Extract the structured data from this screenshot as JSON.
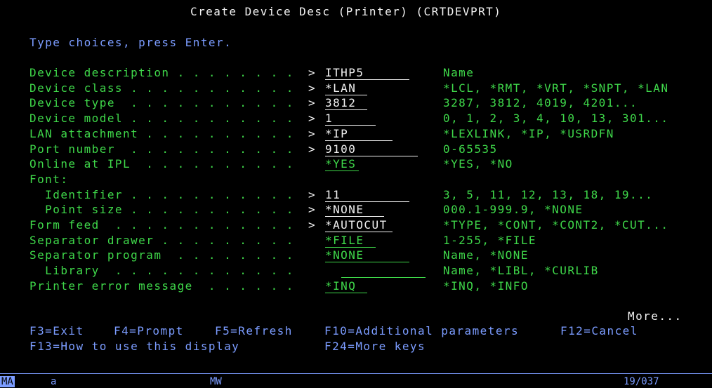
{
  "header": {
    "title": "Create Device Desc (Printer) (CRTDEVPRT)"
  },
  "instructions": "Type choices, press Enter.",
  "parameters": [
    {
      "key": "device_description",
      "prompt": "Device description . . . . . . . .",
      "prompt_marker": ">",
      "value": "ITHP5",
      "choices": "Name"
    },
    {
      "key": "device_class",
      "prompt": "Device class . . . . . . . . . . .",
      "prompt_marker": ">",
      "value": "*LAN",
      "choices": "*LCL, *RMT, *VRT, *SNPT, *LAN"
    },
    {
      "key": "device_type",
      "prompt": "Device type  . . . . . . . . . . .",
      "prompt_marker": ">",
      "value": "3812",
      "choices": "3287, 3812, 4019, 4201..."
    },
    {
      "key": "device_model",
      "prompt": "Device model . . . . . . . . . . .",
      "prompt_marker": ">",
      "value": "1",
      "choices": "0, 1, 2, 3, 4, 10, 13, 301..."
    },
    {
      "key": "lan_attachment",
      "prompt": "LAN attachment . . . . . . . . . .",
      "prompt_marker": ">",
      "value": "*IP",
      "choices": "*LEXLINK, *IP, *USRDFN"
    },
    {
      "key": "port_number",
      "prompt": "Port number  . . . . . . . . . . .",
      "prompt_marker": ">",
      "value": "9100",
      "choices": "0-65535"
    },
    {
      "key": "online_at_ipl",
      "prompt": "Online at IPL  . . . . . . . . . .",
      "prompt_marker": "",
      "value": "*YES",
      "choices": "*YES, *NO"
    },
    {
      "key": "font_header",
      "prompt": "Font:",
      "prompt_marker": "",
      "value": "",
      "choices": ""
    },
    {
      "key": "font_identifier",
      "prompt": "  Identifier . . . . . . . . . . .",
      "prompt_marker": ">",
      "value": "11",
      "choices": "3, 5, 11, 12, 13, 18, 19..."
    },
    {
      "key": "font_point_size",
      "prompt": "  Point size . . . . . . . . . . .",
      "prompt_marker": ">",
      "value": "*NONE",
      "choices": "000.1-999.9, *NONE"
    },
    {
      "key": "form_feed",
      "prompt": "Form feed  . . . . . . . . . . . .",
      "prompt_marker": ">",
      "value": "*AUTOCUT",
      "choices": "*TYPE, *CONT, *CONT2, *CUT..."
    },
    {
      "key": "separator_drawer",
      "prompt": "Separator drawer . . . . . . . . .",
      "prompt_marker": "",
      "value": "*FILE",
      "choices": "1-255, *FILE"
    },
    {
      "key": "separator_program",
      "prompt": "Separator program  . . . . . . . .",
      "prompt_marker": "",
      "value": "*NONE",
      "choices": "Name, *NONE"
    },
    {
      "key": "library",
      "prompt": "  Library  . . . . . . . . . . . .",
      "prompt_marker": "",
      "value": "",
      "choices": "Name, *LIBL, *CURLIB"
    },
    {
      "key": "printer_error_message",
      "prompt": "Printer error message  . . . . . .",
      "prompt_marker": "",
      "value": "*INQ",
      "choices": "*INQ, *INFO"
    }
  ],
  "more_indicator": "More...",
  "function_keys": {
    "f3": "F3=Exit",
    "f4": "F4=Prompt",
    "f5": "F5=Refresh",
    "f10": "F10=Additional parameters",
    "f12": "F12=Cancel",
    "f13": "F13=How to use this display",
    "f24": "F24=More keys"
  },
  "status_bar": {
    "session_indicator": "MA",
    "session_id": "a",
    "mode": "MW",
    "cursor_position": "19/037"
  },
  "colors": {
    "background": "#000000",
    "field_text": "#3fd84a",
    "title_text": "#f2f2f2",
    "function_keys": "#7b9cff"
  }
}
